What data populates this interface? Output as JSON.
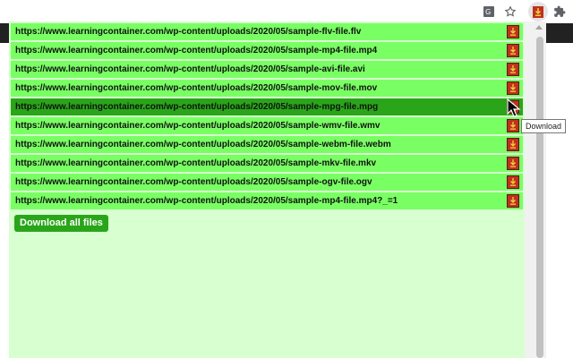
{
  "rows": [
    {
      "url": "https://www.learningcontainer.com/wp-content/uploads/2020/05/sample-flv-file.flv"
    },
    {
      "url": "https://www.learningcontainer.com/wp-content/uploads/2020/05/sample-mp4-file.mp4"
    },
    {
      "url": "https://www.learningcontainer.com/wp-content/uploads/2020/05/sample-avi-file.avi"
    },
    {
      "url": "https://www.learningcontainer.com/wp-content/uploads/2020/05/sample-mov-file.mov"
    },
    {
      "url": "https://www.learningcontainer.com/wp-content/uploads/2020/05/sample-mpg-file.mpg"
    },
    {
      "url": "https://www.learningcontainer.com/wp-content/uploads/2020/05/sample-wmv-file.wmv"
    },
    {
      "url": "https://www.learningcontainer.com/wp-content/uploads/2020/05/sample-webm-file.webm"
    },
    {
      "url": "https://www.learningcontainer.com/wp-content/uploads/2020/05/sample-mkv-file.mkv"
    },
    {
      "url": "https://www.learningcontainer.com/wp-content/uploads/2020/05/sample-ogv-file.ogv"
    },
    {
      "url": "https://www.learningcontainer.com/wp-content/uploads/2020/05/sample-mp4-file.mp4?_=1"
    }
  ],
  "download_all_label": "Download all files",
  "tooltip": "Download",
  "colors": {
    "popup_bg": "#d7ffd0",
    "row_bg": "#79ff63",
    "row_active_bg": "#2aa51a",
    "download_icon_bg": "#c03020"
  },
  "icons": {
    "toolbar": [
      "translate-icon",
      "star-icon",
      "extension-download-icon",
      "puzzle-icon"
    ],
    "row_action": "download-icon"
  }
}
